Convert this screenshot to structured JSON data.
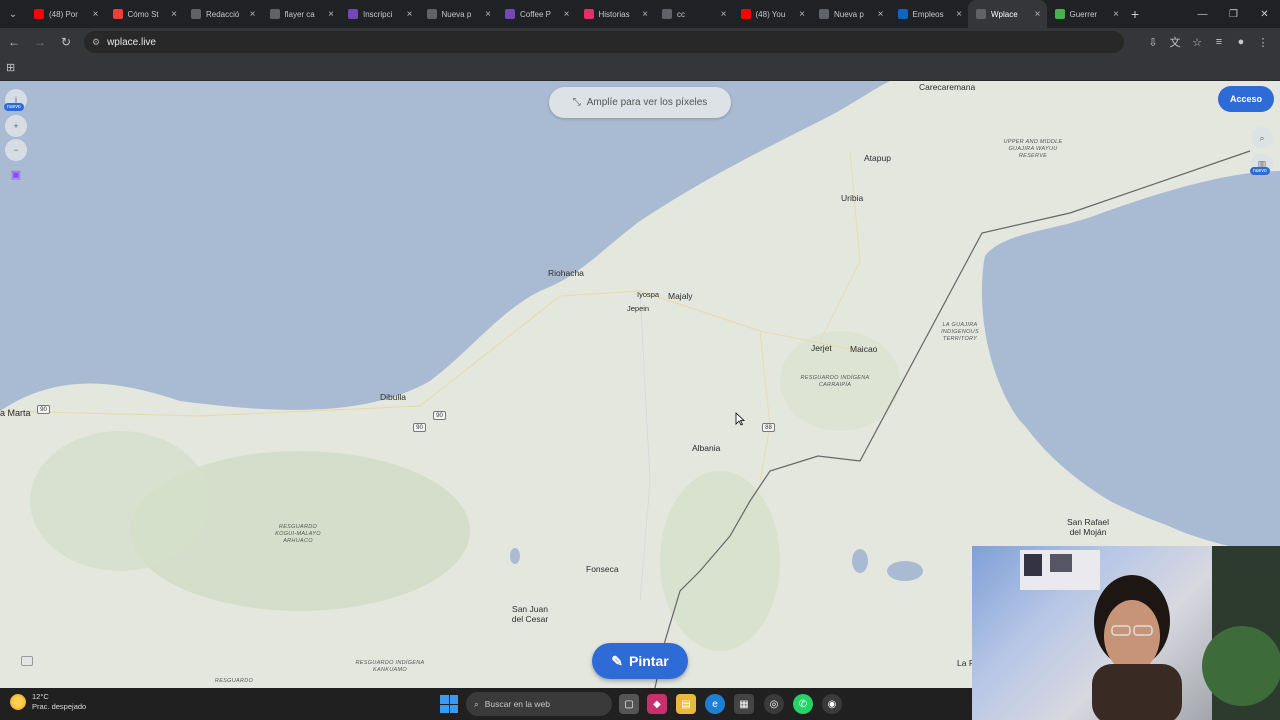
{
  "browser": {
    "tabs": [
      {
        "title": "(48) Por",
        "color": "#ff0000",
        "icon": "youtube-icon"
      },
      {
        "title": "Cómo St",
        "color": "#ea4335",
        "icon": "gmail-icon"
      },
      {
        "title": "Redacció",
        "color": "#5f6368",
        "icon": "globe-icon"
      },
      {
        "title": "flayer ca",
        "color": "#5f6368",
        "icon": "google-icon"
      },
      {
        "title": "Inscripci",
        "color": "#7248b9",
        "icon": "forms-icon"
      },
      {
        "title": "Nueva p",
        "color": "#5f6368",
        "icon": "globe-icon"
      },
      {
        "title": "Coffee P",
        "color": "#7248b9",
        "icon": "forms-icon"
      },
      {
        "title": "Historias",
        "color": "#e1306c",
        "icon": "instagram-icon"
      },
      {
        "title": "cc",
        "color": "#5f6368",
        "icon": "globe-icon"
      },
      {
        "title": "(48) You",
        "color": "#ff0000",
        "icon": "youtube-icon"
      },
      {
        "title": "Nueva p",
        "color": "#5f6368",
        "icon": "globe-icon"
      },
      {
        "title": "Empleos",
        "color": "#0a66c2",
        "icon": "linkedin-icon"
      },
      {
        "title": "Wplace",
        "color": "#5f6368",
        "icon": "wplace-icon",
        "active": true
      },
      {
        "title": "Guerrer",
        "color": "#4caf50",
        "icon": "k-icon"
      }
    ],
    "url": "wplace.live"
  },
  "map": {
    "zoom_hint": "Amplíe para ver los píxeles",
    "login_label": "Acceso",
    "paint_label": "Pintar",
    "new_badge": "nuevo",
    "labels": {
      "carecaremana": "Carecaremana",
      "atapup": "Atapup",
      "uribia": "Uribia",
      "riohacha": "Riohacha",
      "iyospa": "Iyospa",
      "majaly": "Majaly",
      "jepein": "Jepein",
      "jerjet": "Jerjet",
      "maicao": "Maicao",
      "dibulla": "Dibulla",
      "albania": "Albania",
      "santa_marta": "a Marta",
      "fonseca": "Fonseca",
      "san_juan": "San Juan del Cesar",
      "san_rafael": "San Rafael del Moján",
      "la_fa": "La F",
      "reserve_guajira": "UPPER AND MIDDLE GUAJIRA WAYUU RESERVE",
      "reserve_lagg": "LA GUAJIRA INDIGENOUS TERRITORY",
      "reserve_carraipia": "RESGUARDO INDÍGENA CARRAIPÍA",
      "reserve_kogui": "RESGUARDO KOGUI-MALAYO ARHUACO",
      "reserve_kankuamo": "RESGUARDO INDÍGENA KANKUAMO",
      "reserve_bottom": "RESGUARDO"
    },
    "road_shields": [
      "90",
      "90",
      "90",
      "88"
    ]
  },
  "taskbar": {
    "temp": "12°C",
    "weather": "Prac. despejado",
    "search_placeholder": "Buscar en la web"
  },
  "colors": {
    "accent": "#2f6bd6",
    "sea": "#a9bbd3",
    "land": "#e4e7de"
  }
}
